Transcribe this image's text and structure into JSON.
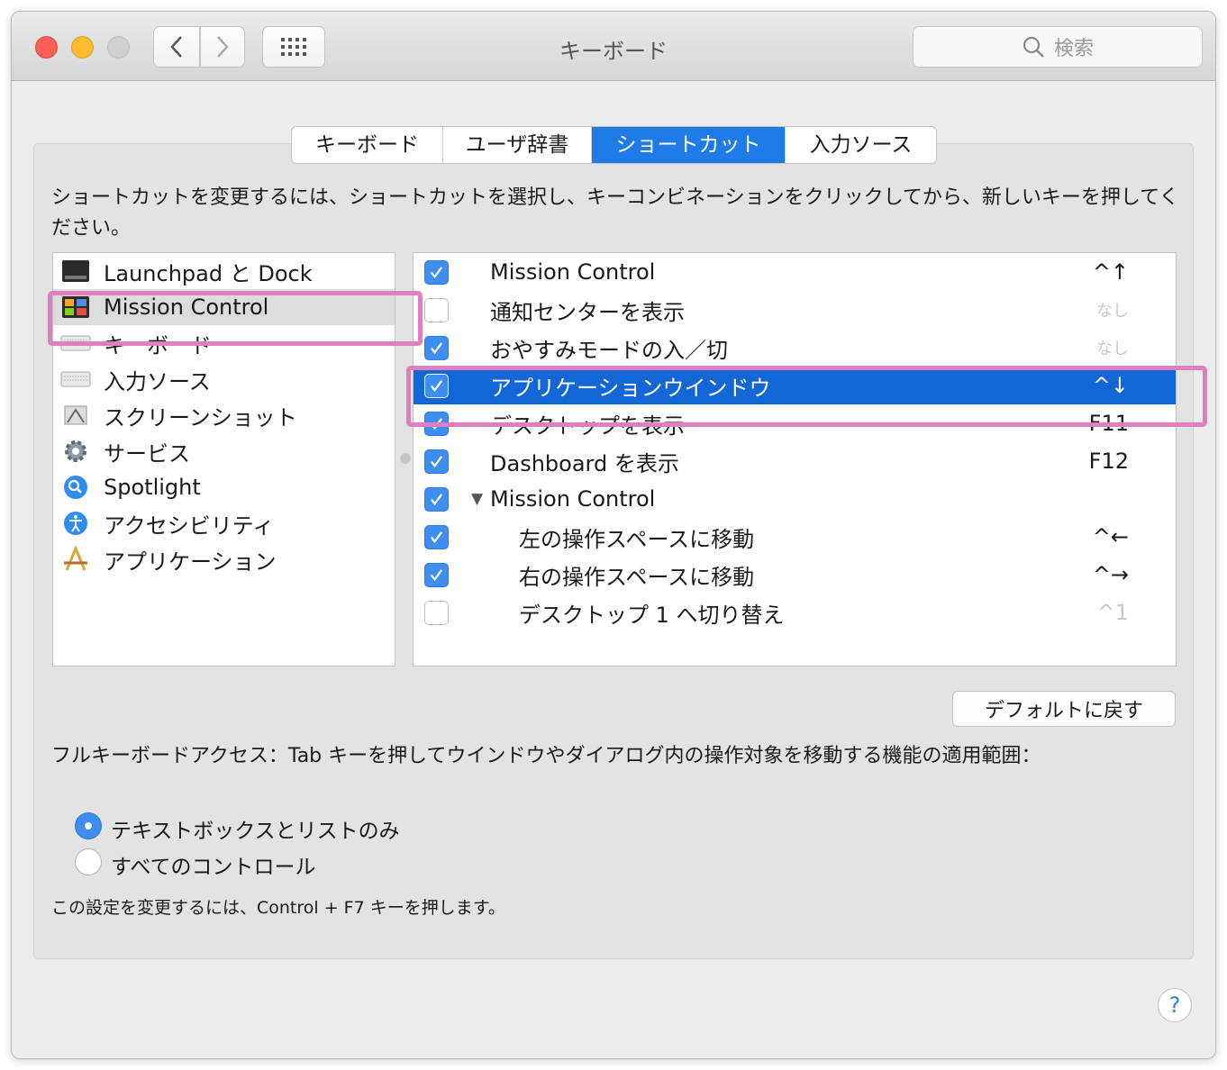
{
  "window": {
    "title": "キーボード"
  },
  "search": {
    "placeholder": "検索"
  },
  "tabs": [
    {
      "label": "キーボード"
    },
    {
      "label": "ユーザ辞書"
    },
    {
      "label": "ショートカット"
    },
    {
      "label": "入力ソース"
    }
  ],
  "description": "ショートカットを変更するには、ショートカットを選択し、キーコンビネーションをクリックしてから、新しいキーを押してください。",
  "categories": [
    {
      "label": "Launchpad と Dock",
      "icon": "launchpad-icon"
    },
    {
      "label": "Mission Control",
      "icon": "mission-control-icon"
    },
    {
      "label": "キーボード",
      "icon": "keyboard-icon"
    },
    {
      "label": "入力ソース",
      "icon": "keyboard-icon"
    },
    {
      "label": "スクリーンショット",
      "icon": "screenshot-icon"
    },
    {
      "label": "サービス",
      "icon": "gear-icon"
    },
    {
      "label": "Spotlight",
      "icon": "spotlight-icon"
    },
    {
      "label": "アクセシビリティ",
      "icon": "accessibility-icon"
    },
    {
      "label": "アプリケーション",
      "icon": "app-store-icon"
    }
  ],
  "shortcuts": [
    {
      "label": "Mission Control",
      "key": "^↑",
      "checked": true
    },
    {
      "label": "通知センターを表示",
      "key": "なし",
      "checked": false
    },
    {
      "label": "おやすみモードの入／切",
      "key": "なし",
      "checked": true
    },
    {
      "label": "アプリケーションウインドウ",
      "key": "^↓",
      "checked": true
    },
    {
      "label": "デスクトップを表示",
      "key": "F11",
      "checked": true
    },
    {
      "label": "Dashboard を表示",
      "key": "F12",
      "checked": true
    },
    {
      "label": "Mission Control",
      "key": "",
      "checked": true
    },
    {
      "label": "左の操作スペースに移動",
      "key": "^←",
      "checked": true
    },
    {
      "label": "右の操作スペースに移動",
      "key": "^→",
      "checked": true
    },
    {
      "label": "デスクトップ 1 へ切り替え",
      "key": "^1",
      "checked": false
    }
  ],
  "default_button": "デフォルトに戻す",
  "full_keyboard_access": "フルキーボードアクセス：Tab キーを押してウインドウやダイアログ内の操作対象を移動する機能の適用範囲：",
  "radio_options": [
    {
      "label": "テキストボックスとリストのみ",
      "selected": true
    },
    {
      "label": "すべてのコントロール",
      "selected": false
    }
  ],
  "note": "この設定を変更するには、Control + F7 キーを押します。",
  "help_label": "?",
  "colors": {
    "accent": "#1366d6",
    "highlight": "#df7fc0",
    "checkbox": "#3d8ef0"
  }
}
